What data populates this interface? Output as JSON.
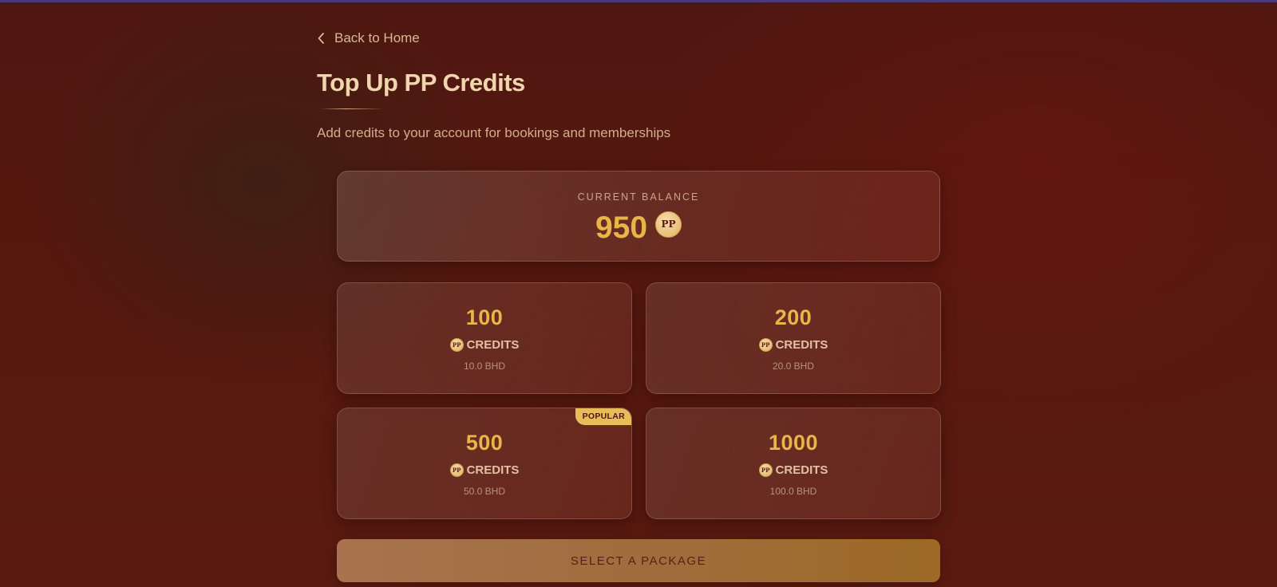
{
  "nav": {
    "back_label": "Back to Home"
  },
  "header": {
    "title": "Top Up PP Credits",
    "subtitle": "Add credits to your account for bookings and memberships"
  },
  "balance": {
    "label": "CURRENT BALANCE",
    "value": "950",
    "coin_text": "PP"
  },
  "packages": [
    {
      "amount": "100",
      "unit": "CREDITS",
      "price": "10.0 BHD",
      "coin_text": "PP"
    },
    {
      "amount": "200",
      "unit": "CREDITS",
      "price": "20.0 BHD",
      "coin_text": "PP"
    },
    {
      "amount": "500",
      "unit": "CREDITS",
      "price": "50.0 BHD",
      "coin_text": "PP",
      "badge": "POPULAR"
    },
    {
      "amount": "1000",
      "unit": "CREDITS",
      "price": "100.0 BHD",
      "coin_text": "PP"
    }
  ],
  "action": {
    "button_label": "SELECT A PACKAGE"
  },
  "colors": {
    "accent_gold": "#e9b548",
    "background": "#56180f",
    "text_light": "#f0d6ad",
    "badge": "#e7bd5a"
  },
  "icons": {
    "back": "chevron-left-icon",
    "coin": "pp-coin-icon"
  }
}
